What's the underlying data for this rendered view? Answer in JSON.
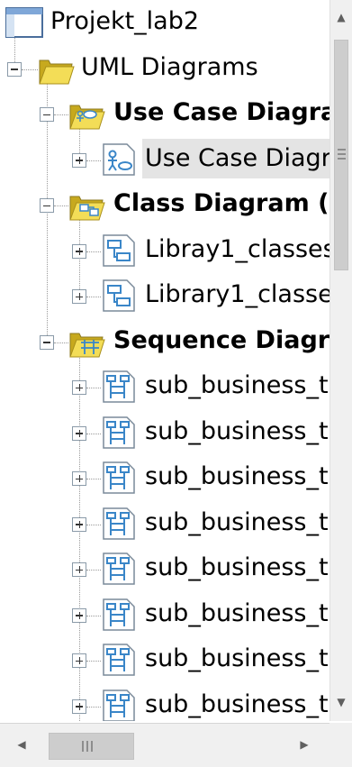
{
  "tree": {
    "nodes": [
      {
        "id": "root",
        "label": "Projekt_lab2",
        "level": 0,
        "bold": false,
        "icon": "project-window-icon",
        "expander": "none"
      },
      {
        "id": "uml",
        "label": "UML Diagrams",
        "level": 1,
        "bold": false,
        "icon": "folder-open-icon",
        "expander": "minus"
      },
      {
        "id": "usecase-group",
        "label": "Use Case Diagra",
        "level": 2,
        "bold": true,
        "icon": "use-case-folder-icon",
        "expander": "minus"
      },
      {
        "id": "usecase-1",
        "label": "Use Case Diagra",
        "level": 3,
        "bold": false,
        "icon": "use-case-diagram-icon",
        "expander": "plus",
        "selected": true
      },
      {
        "id": "class-group",
        "label": "Class Diagram (",
        "level": 2,
        "bold": true,
        "icon": "class-folder-icon",
        "expander": "minus"
      },
      {
        "id": "class-1",
        "label": "Libray1_classes",
        "level": 3,
        "bold": false,
        "icon": "class-diagram-icon",
        "expander": "plus"
      },
      {
        "id": "class-2",
        "label": "Library1_classe",
        "level": 3,
        "bold": false,
        "icon": "class-diagram-icon",
        "expander": "plus"
      },
      {
        "id": "seq-group",
        "label": "Sequence Diagr",
        "level": 2,
        "bold": true,
        "icon": "sequence-folder-icon",
        "expander": "minus"
      },
      {
        "id": "seq-1",
        "label": "sub_business_t",
        "level": 3,
        "bold": false,
        "icon": "sequence-diagram-icon",
        "expander": "plus"
      },
      {
        "id": "seq-2",
        "label": "sub_business_t",
        "level": 3,
        "bold": false,
        "icon": "sequence-diagram-icon",
        "expander": "plus"
      },
      {
        "id": "seq-3",
        "label": "sub_business_t",
        "level": 3,
        "bold": false,
        "icon": "sequence-diagram-icon",
        "expander": "plus"
      },
      {
        "id": "seq-4",
        "label": "sub_business_t",
        "level": 3,
        "bold": false,
        "icon": "sequence-diagram-icon",
        "expander": "plus"
      },
      {
        "id": "seq-5",
        "label": "sub_business_t",
        "level": 3,
        "bold": false,
        "icon": "sequence-diagram-icon",
        "expander": "plus"
      },
      {
        "id": "seq-6",
        "label": "sub_business_t",
        "level": 3,
        "bold": false,
        "icon": "sequence-diagram-icon",
        "expander": "plus"
      },
      {
        "id": "seq-7",
        "label": "sub_business_t",
        "level": 3,
        "bold": false,
        "icon": "sequence-diagram-icon",
        "expander": "plus"
      },
      {
        "id": "seq-8",
        "label": "sub_business_t",
        "level": 3,
        "bold": false,
        "icon": "sequence-diagram-icon",
        "expander": "plus"
      }
    ]
  },
  "scrollbars": {
    "vertical": {
      "up_icon": "arrow-up-icon",
      "down_icon": "arrow-down-icon"
    },
    "horizontal": {
      "left_icon": "arrow-left-icon",
      "right_icon": "arrow-right-icon"
    }
  },
  "colors": {
    "folder": "#f3dd57",
    "folder_dark": "#c7a91e",
    "diagram_blue": "#3a86c8",
    "selection": "#e4e4e4"
  }
}
